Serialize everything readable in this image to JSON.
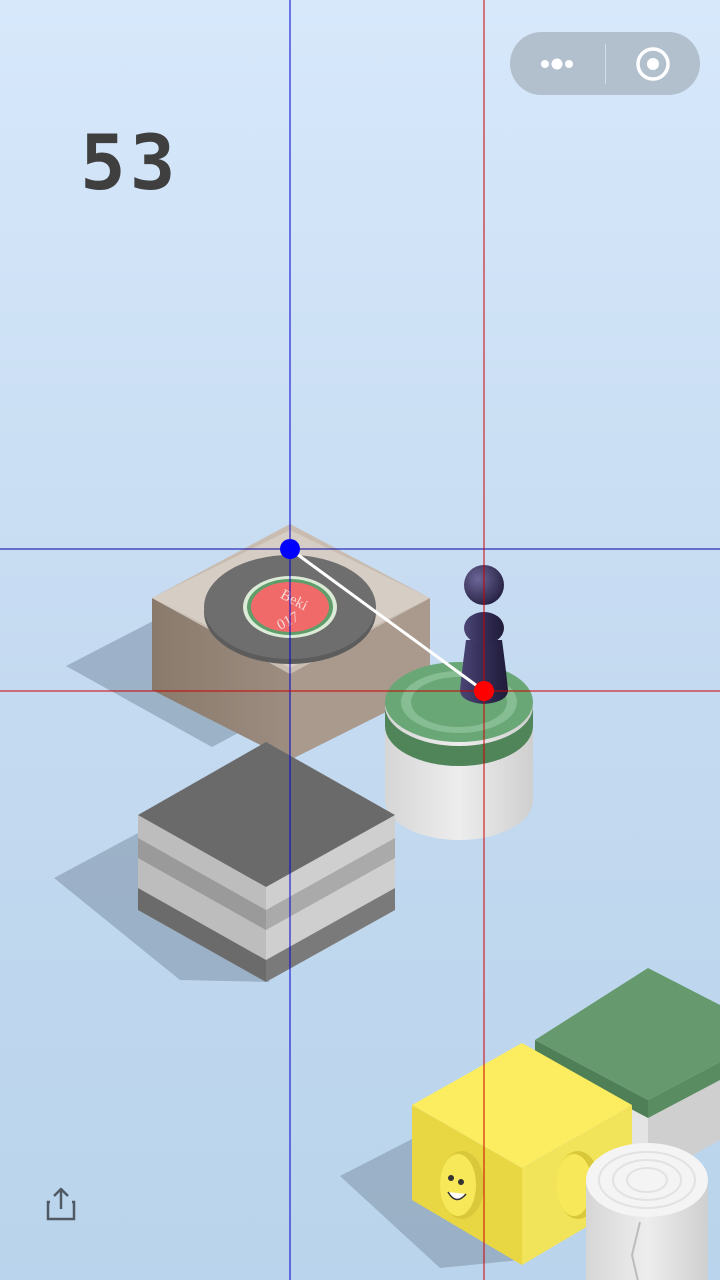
{
  "game": {
    "score": "53"
  },
  "pad_label": {
    "line1": "Beki",
    "line2": "017"
  },
  "icons": {
    "menu": "more-dots-icon",
    "close": "target-close-icon",
    "share": "share-icon"
  },
  "colors": {
    "background_top": "#d7e8fb",
    "background_bottom": "#b9d4ec",
    "score_color": "#3f3f3f",
    "guide_vertical_blue": "#0000cc",
    "guide_horizontal_blue": "#0000aa",
    "guide_red": "#cc0000",
    "marker_blue": "#0000ff",
    "marker_red": "#ff0000",
    "player": "#35305a",
    "pad_ring": "#f06a6a"
  }
}
